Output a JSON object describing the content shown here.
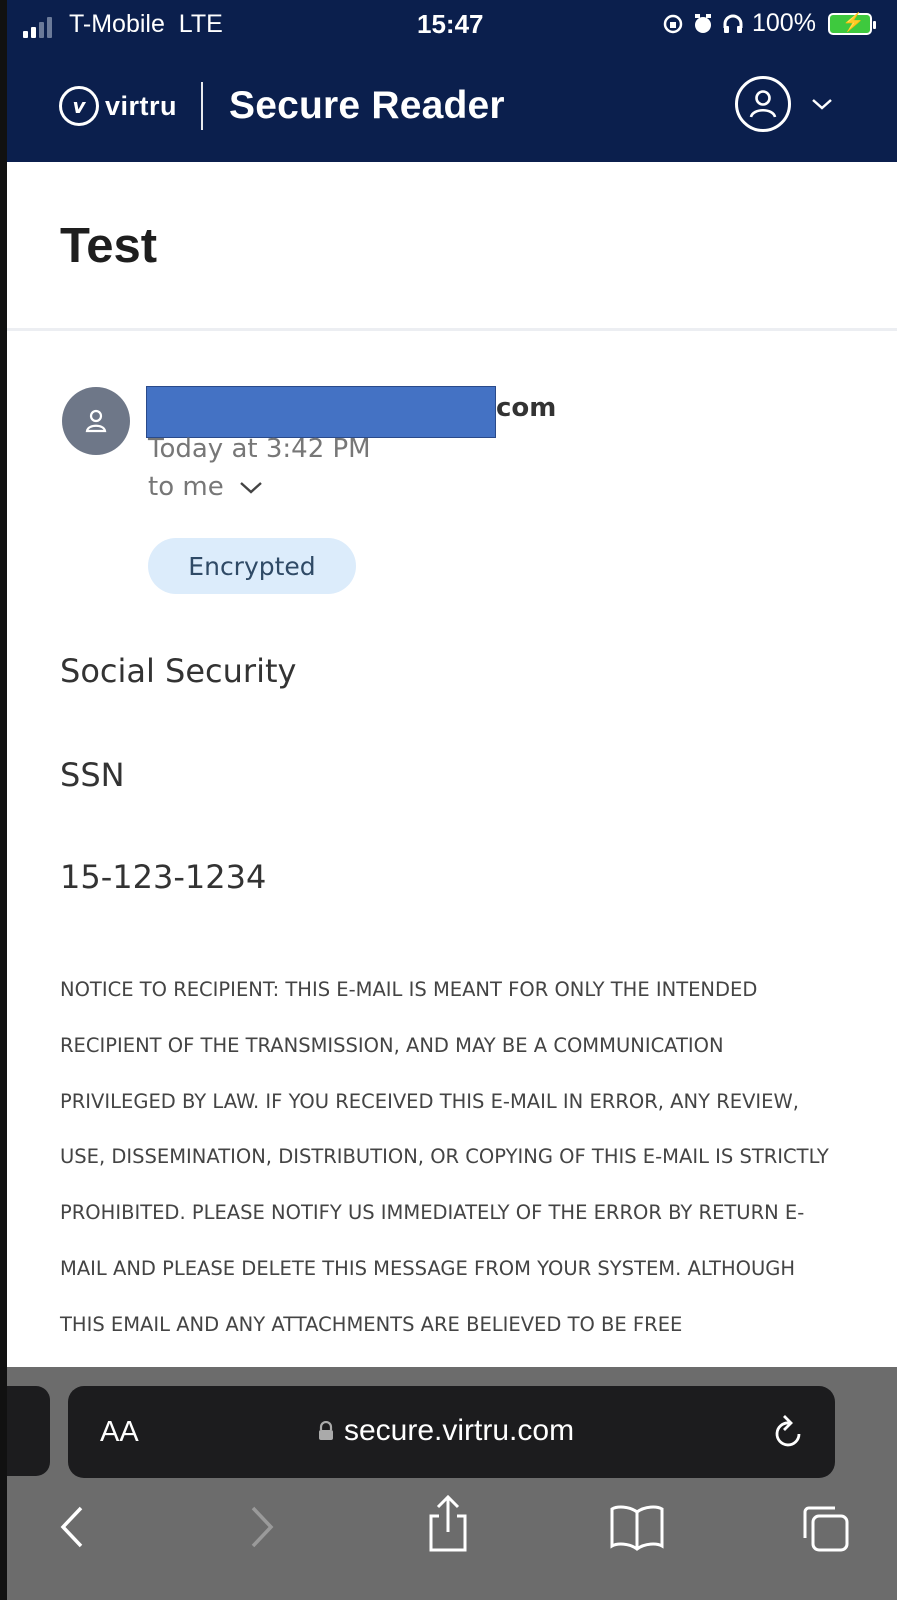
{
  "status_bar": {
    "carrier": "T-Mobile",
    "network": "LTE",
    "time": "15:47",
    "battery": "100%"
  },
  "header": {
    "brand": "virtru",
    "title": "Secure Reader",
    "background_color": "#0b1f4d"
  },
  "message": {
    "subject": "Test",
    "sender_suffix": "com",
    "sent_time": "Today at 3:42 PM",
    "recipients": "to me",
    "encryption_badge": "Encrypted",
    "body_lines": [
      "Social Security",
      "SSN",
      "15-123-1234"
    ],
    "notice": "NOTICE TO RECIPIENT: THIS E-MAIL IS MEANT FOR ONLY THE INTENDED RECIPIENT OF THE TRANSMISSION, AND MAY BE A COMMUNICATION PRIVILEGED BY LAW. IF YOU RECEIVED THIS E-MAIL IN ERROR, ANY REVIEW, USE, DISSEMINATION, DISTRIBUTION, OR COPYING OF THIS E-MAIL IS STRICTLY PROHIBITED. PLEASE NOTIFY US IMMEDIATELY OF THE ERROR BY RETURN E-MAIL AND PLEASE DELETE THIS MESSAGE FROM YOUR SYSTEM. ALTHOUGH THIS EMAIL AND ANY ATTACHMENTS ARE BELIEVED TO BE FREE"
  },
  "browser": {
    "text_size_button": "AA",
    "url": "secure.virtru.com",
    "icons": [
      "back-icon",
      "forward-icon",
      "share-icon",
      "bookmarks-icon",
      "tabs-icon",
      "reload-icon",
      "lock-icon"
    ]
  }
}
